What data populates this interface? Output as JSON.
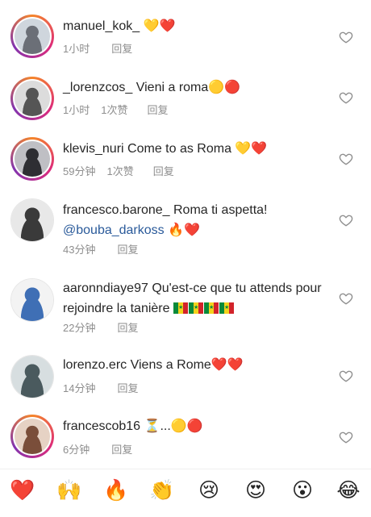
{
  "comments": [
    {
      "username": "manuel_kok_",
      "text": "💛❤️",
      "time": "1小时",
      "likes": "",
      "reply": "回复",
      "avatar_colors": [
        "#cfd6dd",
        "#6b6f77"
      ],
      "story": true
    },
    {
      "username": "_lorenzcos_",
      "text": "Vieni a roma🟡🔴",
      "time": "1小时",
      "likes": "1次赞",
      "reply": "回复",
      "avatar_colors": [
        "#dcdcdc",
        "#555555"
      ],
      "story": true
    },
    {
      "username": "klevis_nuri",
      "text": "Come to as Roma 💛❤️",
      "time": "59分钟",
      "likes": "1次赞",
      "reply": "回复",
      "avatar_colors": [
        "#bfbfc4",
        "#2e2e33"
      ],
      "story": true
    },
    {
      "username": "francesco.barone_",
      "text": "Roma ti aspetta!",
      "mention": "@bouba_darkoss",
      "mention_suffix": " 🔥❤️",
      "time": "43分钟",
      "likes": "",
      "reply": "回复",
      "avatar_colors": [
        "#e8e8e8",
        "#3a3a3a"
      ],
      "story": false
    },
    {
      "username": "aaronndiaye97",
      "text": "Qu'est-ce que tu attends pour rejoindre la tanière",
      "time": "22分钟",
      "likes": "",
      "reply": "回复",
      "avatar_colors": [
        "#f3f3f3",
        "#3f6fb5"
      ],
      "story": false
    },
    {
      "username": "lorenzo.erc",
      "text": "Viens a Rome❤️❤️",
      "time": "14分钟",
      "likes": "",
      "reply": "回复",
      "avatar_colors": [
        "#d7dee0",
        "#4a5a5e"
      ],
      "story": false
    },
    {
      "username": "francescob16",
      "text": "⏳...🟡🔴",
      "time": "6分钟",
      "likes": "",
      "reply": "回复",
      "avatar_colors": [
        "#e6d2c4",
        "#7a4e3a"
      ],
      "story": true
    }
  ],
  "flag_colors": [
    "#0a8a3a",
    "#f4d21c",
    "#d2232a"
  ],
  "emoji_bar": [
    "❤️",
    "🙌",
    "🔥",
    "👏",
    "😢",
    "😍",
    "😮",
    "😂"
  ]
}
